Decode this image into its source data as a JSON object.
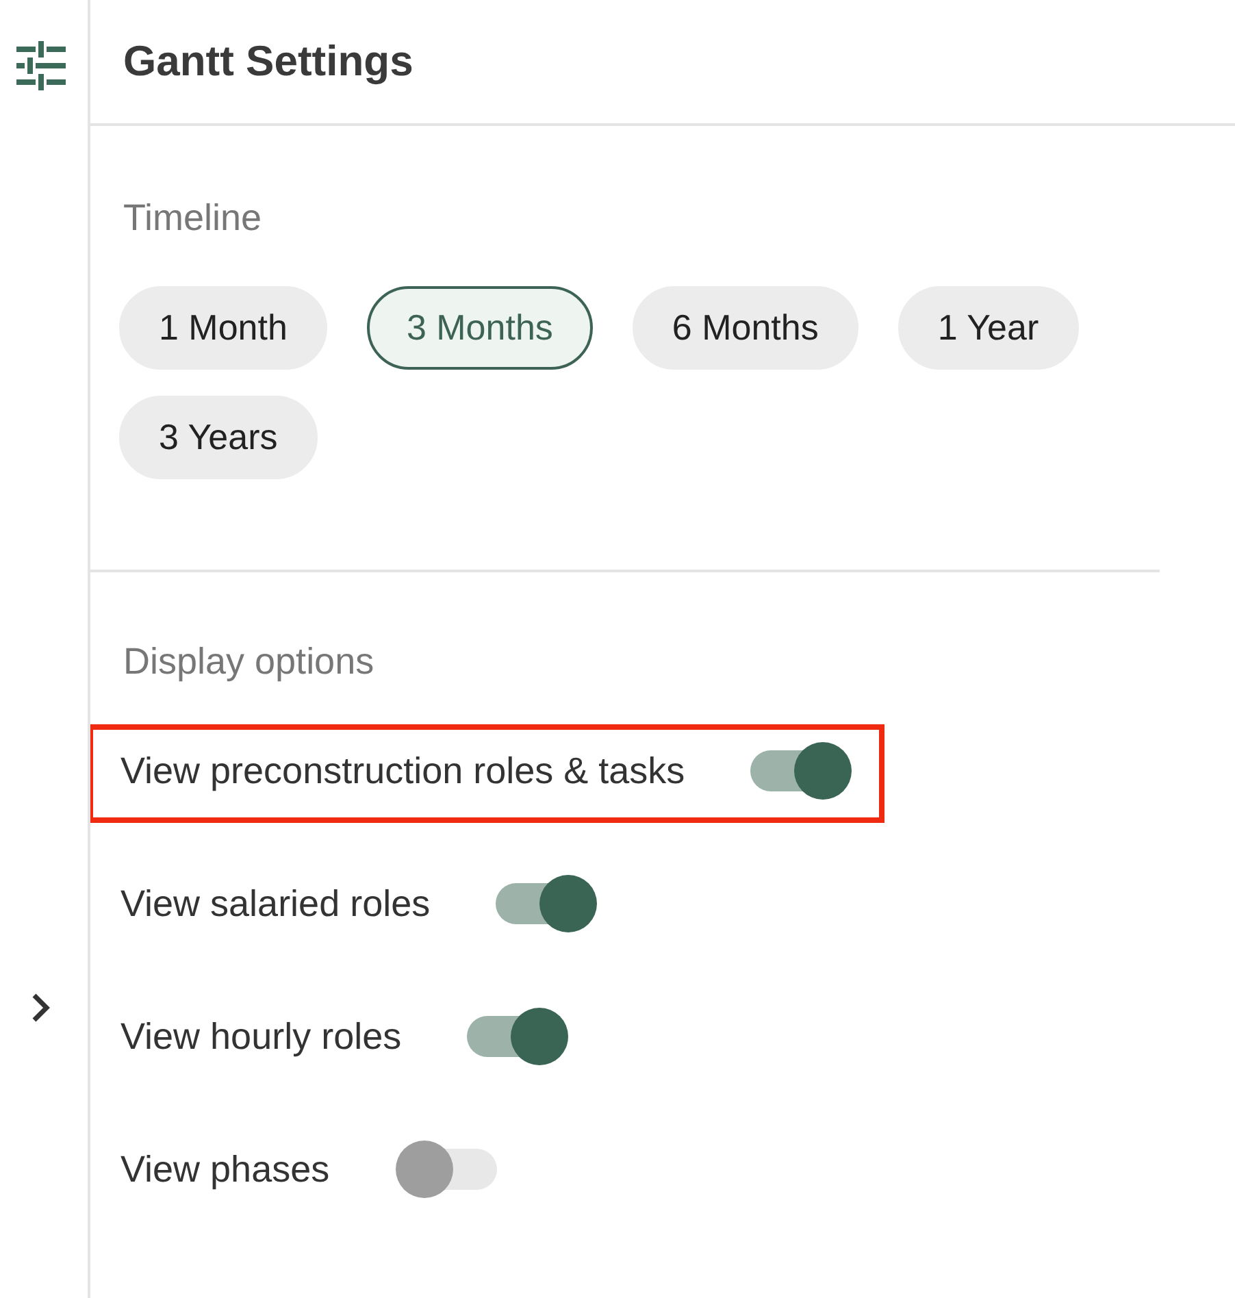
{
  "header": {
    "title": "Gantt Settings"
  },
  "timeline": {
    "heading": "Timeline",
    "options": [
      {
        "label": "1 Month",
        "selected": false
      },
      {
        "label": "3 Months",
        "selected": true
      },
      {
        "label": "6 Months",
        "selected": false
      },
      {
        "label": "1 Year",
        "selected": false
      },
      {
        "label": "3 Years",
        "selected": false
      }
    ]
  },
  "display_options": {
    "heading": "Display options",
    "toggles": [
      {
        "label": "View preconstruction roles & tasks",
        "on": true,
        "highlighted": true
      },
      {
        "label": "View salaried roles",
        "on": true,
        "highlighted": false
      },
      {
        "label": "View hourly roles",
        "on": true,
        "highlighted": false
      },
      {
        "label": "View phases",
        "on": false,
        "highlighted": false
      }
    ]
  }
}
